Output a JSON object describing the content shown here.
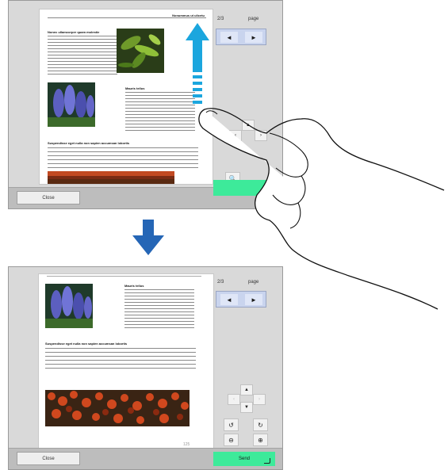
{
  "page_indicator": {
    "count": "2/3",
    "label": "page"
  },
  "nav": {
    "prev": "◄",
    "next": "►"
  },
  "close_label": "Close",
  "send_label": "Send",
  "document": {
    "header_title": "Nonummus ut ulicetu",
    "heading_1": "Nonec ullamcorper quam molestie",
    "heading_2": "Mauris tellus",
    "heading_3": "Suspendisse eget nulla non sapien accumsan lobortis",
    "page_number": "125"
  },
  "colors": {
    "arrow": "#1ba6de",
    "down_arrow": "#2566b6",
    "send": "#3dea9a"
  },
  "icons": [
    "up-arrow-icon",
    "down-arrow-icon",
    "prev-page-icon",
    "next-page-icon",
    "scroll-up-icon",
    "scroll-down-icon",
    "rotate-left-icon",
    "rotate-right-icon",
    "zoom-out-icon",
    "zoom-in-icon",
    "finger-hand-icon"
  ]
}
